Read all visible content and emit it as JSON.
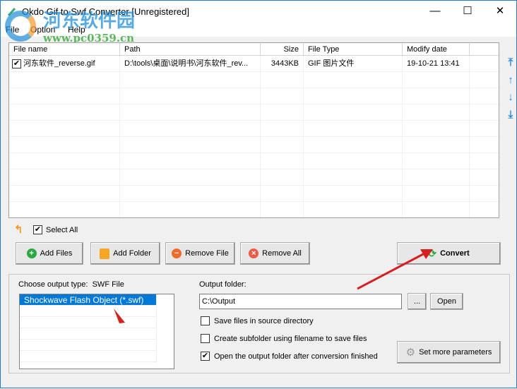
{
  "window": {
    "title": "Okdo Gif to Swf Converter [Unregistered]",
    "minimize": "—",
    "maximize": "☐",
    "close": "✕"
  },
  "watermark": {
    "brand": "河东软件园",
    "url": "www.pc0359.cn"
  },
  "menu": [
    "File",
    "Option",
    "Help"
  ],
  "file_list": {
    "columns": [
      "File name",
      "Path",
      "Size",
      "File Type",
      "Modify date"
    ],
    "rows": [
      {
        "checked": true,
        "name": "河东软件_reverse.gif",
        "path": "D:\\tools\\桌面\\说明书\\河东软件_rev...",
        "size": "3443KB",
        "type": "GIF 图片文件",
        "date": "19-10-21 13:41"
      }
    ]
  },
  "side_buttons": [
    "move-top",
    "move-up",
    "move-down",
    "move-bottom"
  ],
  "select_all": {
    "label": "Select All",
    "checked": true
  },
  "buttons": {
    "add_files": "Add Files",
    "add_folder": "Add Folder",
    "remove_file": "Remove File",
    "remove_all": "Remove All",
    "convert": "Convert"
  },
  "output": {
    "type_label": "Choose output type:",
    "type_value": "SWF File",
    "types": [
      "Shockwave Flash Object (*.swf)"
    ],
    "folder_label": "Output folder:",
    "folder_value": "C:\\Output",
    "browse": "...",
    "open": "Open",
    "options": [
      {
        "label": "Save files in source directory",
        "checked": false
      },
      {
        "label": "Create subfolder using filename to save files",
        "checked": false
      },
      {
        "label": "Open the output folder after conversion finished",
        "checked": true
      }
    ],
    "more_params": "Set more parameters"
  },
  "colors": {
    "accent": "#0078d7",
    "arrow": "#d42020"
  }
}
